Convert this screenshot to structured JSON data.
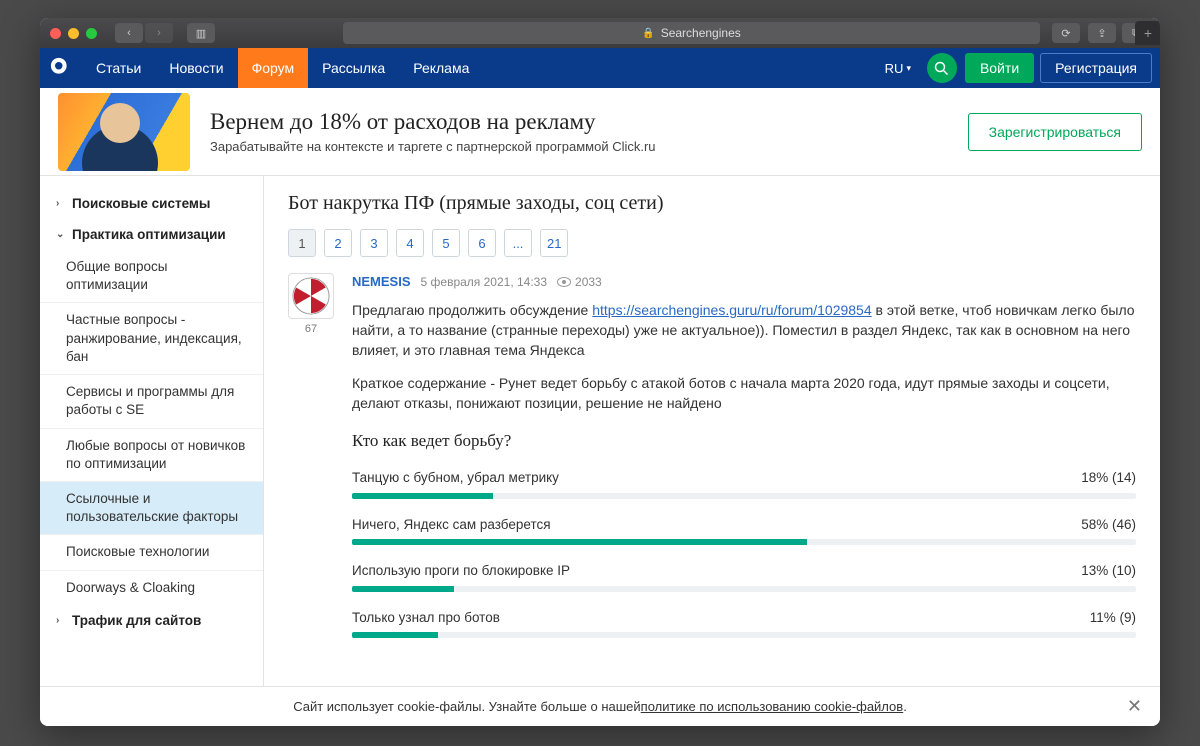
{
  "browser": {
    "title": "Searchengines"
  },
  "nav": {
    "items": [
      "Статьи",
      "Новости",
      "Форум",
      "Рассылка",
      "Реклама"
    ],
    "active_index": 2,
    "lang": "RU",
    "login": "Войти",
    "register": "Регистрация"
  },
  "banner": {
    "title": "Вернем до 18% от расходов на рекламу",
    "subtitle": "Зарабатывайте на контексте и таргете с партнерской программой Click.ru",
    "cta": "Зарегистрироваться"
  },
  "sidebar": {
    "cats": [
      {
        "label": "Поисковые системы",
        "open": false
      },
      {
        "label": "Практика оптимизации",
        "open": true
      },
      {
        "label": "Трафик для сайтов",
        "open": false
      }
    ],
    "items": [
      "Общие вопросы оптимизации",
      "Частные вопросы - ранжирование, индексация, бан",
      "Сервисы и программы для работы с SE",
      "Любые вопросы от новичков по оптимизации",
      "Ссылочные и пользовательские факторы",
      "Поисковые технологии",
      "Doorways & Cloaking"
    ],
    "active_item": 4
  },
  "thread": {
    "title": "Бот накрутка ПФ (прямые заходы, соц сети)",
    "pages": [
      "1",
      "2",
      "3",
      "4",
      "5",
      "6",
      "...",
      "21"
    ],
    "active_page": 0
  },
  "post": {
    "author": "NEMESIS",
    "author_score": "67",
    "date": "5 февраля 2021, 14:33",
    "views": "2033",
    "text_before_link": "Предлагаю продолжить обсуждение ",
    "link": "https://searchengines.guru/ru/forum/1029854",
    "text_after_link": " в этой ветке, чтоб новичкам легко было найти, а то название (странные переходы) уже не актуальное)). Поместил в раздел Яндекс, так как в основном на него влияет, и это главная тема Яндекса",
    "para2": "Краткое содержание - Рунет ведет борьбу с атакой ботов с начала марта 2020 года, идут прямые заходы и соцсети, делают отказы, понижают позиции, решение не найдено",
    "poll_title": "Кто как ведет борьбу?"
  },
  "chart_data": {
    "type": "bar",
    "title": "Кто как ведет борьбу?",
    "categories": [
      "Танцую с бубном, убрал метрику",
      "Ничего, Яндекс сам разберется",
      "Использую проги по блокировке IP",
      "Только узнал про ботов"
    ],
    "values": [
      18,
      58,
      13,
      11
    ],
    "counts": [
      14,
      46,
      10,
      9
    ],
    "xlabel": "",
    "ylabel": "%",
    "ylim": [
      0,
      100
    ]
  },
  "cookie": {
    "text": "Сайт использует cookie-файлы. Узнайте больше о нашей ",
    "link": "политике по использованию cookie-файлов",
    "dot": "."
  }
}
